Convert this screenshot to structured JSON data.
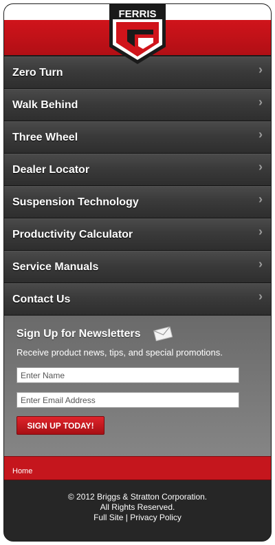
{
  "brand": {
    "logo_text": "FERRIS",
    "primary_color": "#c5161d"
  },
  "nav": {
    "items": [
      {
        "label": "Zero Turn"
      },
      {
        "label": "Walk Behind"
      },
      {
        "label": "Three Wheel"
      },
      {
        "label": "Dealer Locator"
      },
      {
        "label": "Suspension Technology"
      },
      {
        "label": "Productivity Calculator"
      },
      {
        "label": "Service Manuals"
      },
      {
        "label": "Contact Us"
      }
    ],
    "chevron_icon": "chevron-right-icon"
  },
  "newsletter": {
    "title": "Sign Up for Newsletters",
    "subtitle": "Receive product news, tips, and special promotions.",
    "name_placeholder": "Enter Name",
    "email_placeholder": "Enter Email Address",
    "button_label": "SIGN UP TODAY!",
    "icon": "envelope-icon"
  },
  "breadcrumb": {
    "home": "Home"
  },
  "footer": {
    "copyright": "© 2012 Briggs & Stratton Corporation.",
    "rights": "All Rights Reserved.",
    "full_site": "Full Site",
    "separator": "|",
    "privacy": "Privacy Policy"
  }
}
